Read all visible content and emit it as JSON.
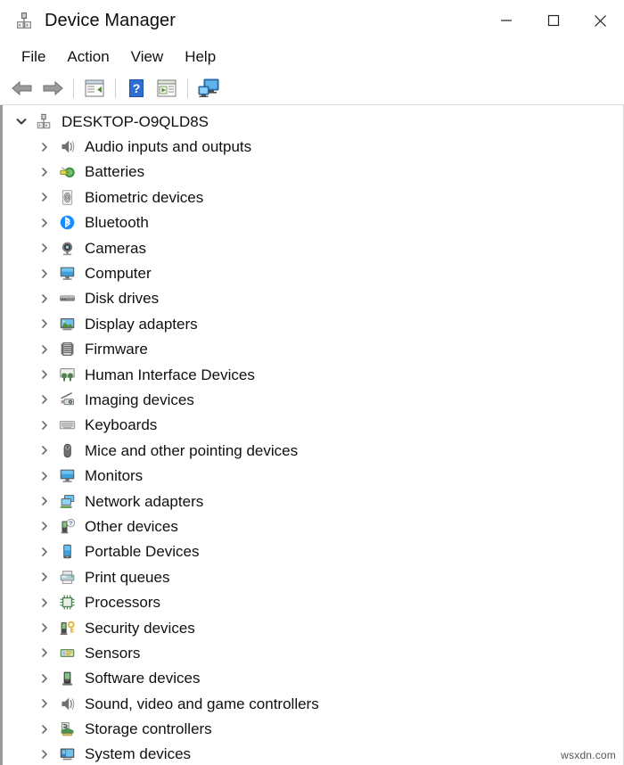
{
  "window": {
    "title": "Device Manager",
    "icon": "device-manager-icon",
    "controls": {
      "minimize": "–",
      "maximize": "□",
      "close": "✕"
    }
  },
  "menubar": {
    "items": [
      {
        "label": "File"
      },
      {
        "label": "Action"
      },
      {
        "label": "View"
      },
      {
        "label": "Help"
      }
    ]
  },
  "toolbar": {
    "buttons": [
      {
        "name": "back-arrow-icon",
        "tooltip": "Back"
      },
      {
        "name": "forward-arrow-icon",
        "tooltip": "Forward"
      },
      {
        "name": "separator-1"
      },
      {
        "name": "properties-icon",
        "tooltip": "Properties"
      },
      {
        "name": "separator-2"
      },
      {
        "name": "help-icon",
        "tooltip": "Help"
      },
      {
        "name": "update-driver-icon",
        "tooltip": "Update driver"
      },
      {
        "name": "separator-3"
      },
      {
        "name": "scan-hardware-changes-icon",
        "tooltip": "Scan for hardware changes"
      }
    ]
  },
  "tree": {
    "root": {
      "label": "DESKTOP-O9QLD8S",
      "icon": "computer-root-icon",
      "expanded": true,
      "twisty": "⌄"
    },
    "twisty_collapsed": "›",
    "items": [
      {
        "label": "Audio inputs and outputs",
        "icon": "speaker-icon"
      },
      {
        "label": "Batteries",
        "icon": "battery-icon"
      },
      {
        "label": "Biometric devices",
        "icon": "fingerprint-icon"
      },
      {
        "label": "Bluetooth",
        "icon": "bluetooth-icon"
      },
      {
        "label": "Cameras",
        "icon": "camera-icon"
      },
      {
        "label": "Computer",
        "icon": "monitor-icon"
      },
      {
        "label": "Disk drives",
        "icon": "disk-drive-icon"
      },
      {
        "label": "Display adapters",
        "icon": "display-adapter-icon"
      },
      {
        "label": "Firmware",
        "icon": "firmware-chip-icon"
      },
      {
        "label": "Human Interface Devices",
        "icon": "hid-icon"
      },
      {
        "label": "Imaging devices",
        "icon": "scanner-icon"
      },
      {
        "label": "Keyboards",
        "icon": "keyboard-icon"
      },
      {
        "label": "Mice and other pointing devices",
        "icon": "mouse-icon"
      },
      {
        "label": "Monitors",
        "icon": "monitor-icon"
      },
      {
        "label": "Network adapters",
        "icon": "network-adapter-icon"
      },
      {
        "label": "Other devices",
        "icon": "other-devices-icon"
      },
      {
        "label": "Portable Devices",
        "icon": "portable-device-icon"
      },
      {
        "label": "Print queues",
        "icon": "printer-icon"
      },
      {
        "label": "Processors",
        "icon": "processor-icon"
      },
      {
        "label": "Security devices",
        "icon": "security-key-icon"
      },
      {
        "label": "Sensors",
        "icon": "sensor-icon"
      },
      {
        "label": "Software devices",
        "icon": "software-device-icon"
      },
      {
        "label": "Sound, video and game controllers",
        "icon": "speaker-icon"
      },
      {
        "label": "Storage controllers",
        "icon": "storage-controller-icon"
      },
      {
        "label": "System devices",
        "icon": "system-device-icon"
      }
    ]
  },
  "watermark": {
    "text": "wsxdn.com"
  },
  "colors": {
    "accent_blue": "#0b79d0",
    "bluetooth_blue": "#1a8cff",
    "border_gray": "#9a9a9a",
    "text": "#101010"
  }
}
